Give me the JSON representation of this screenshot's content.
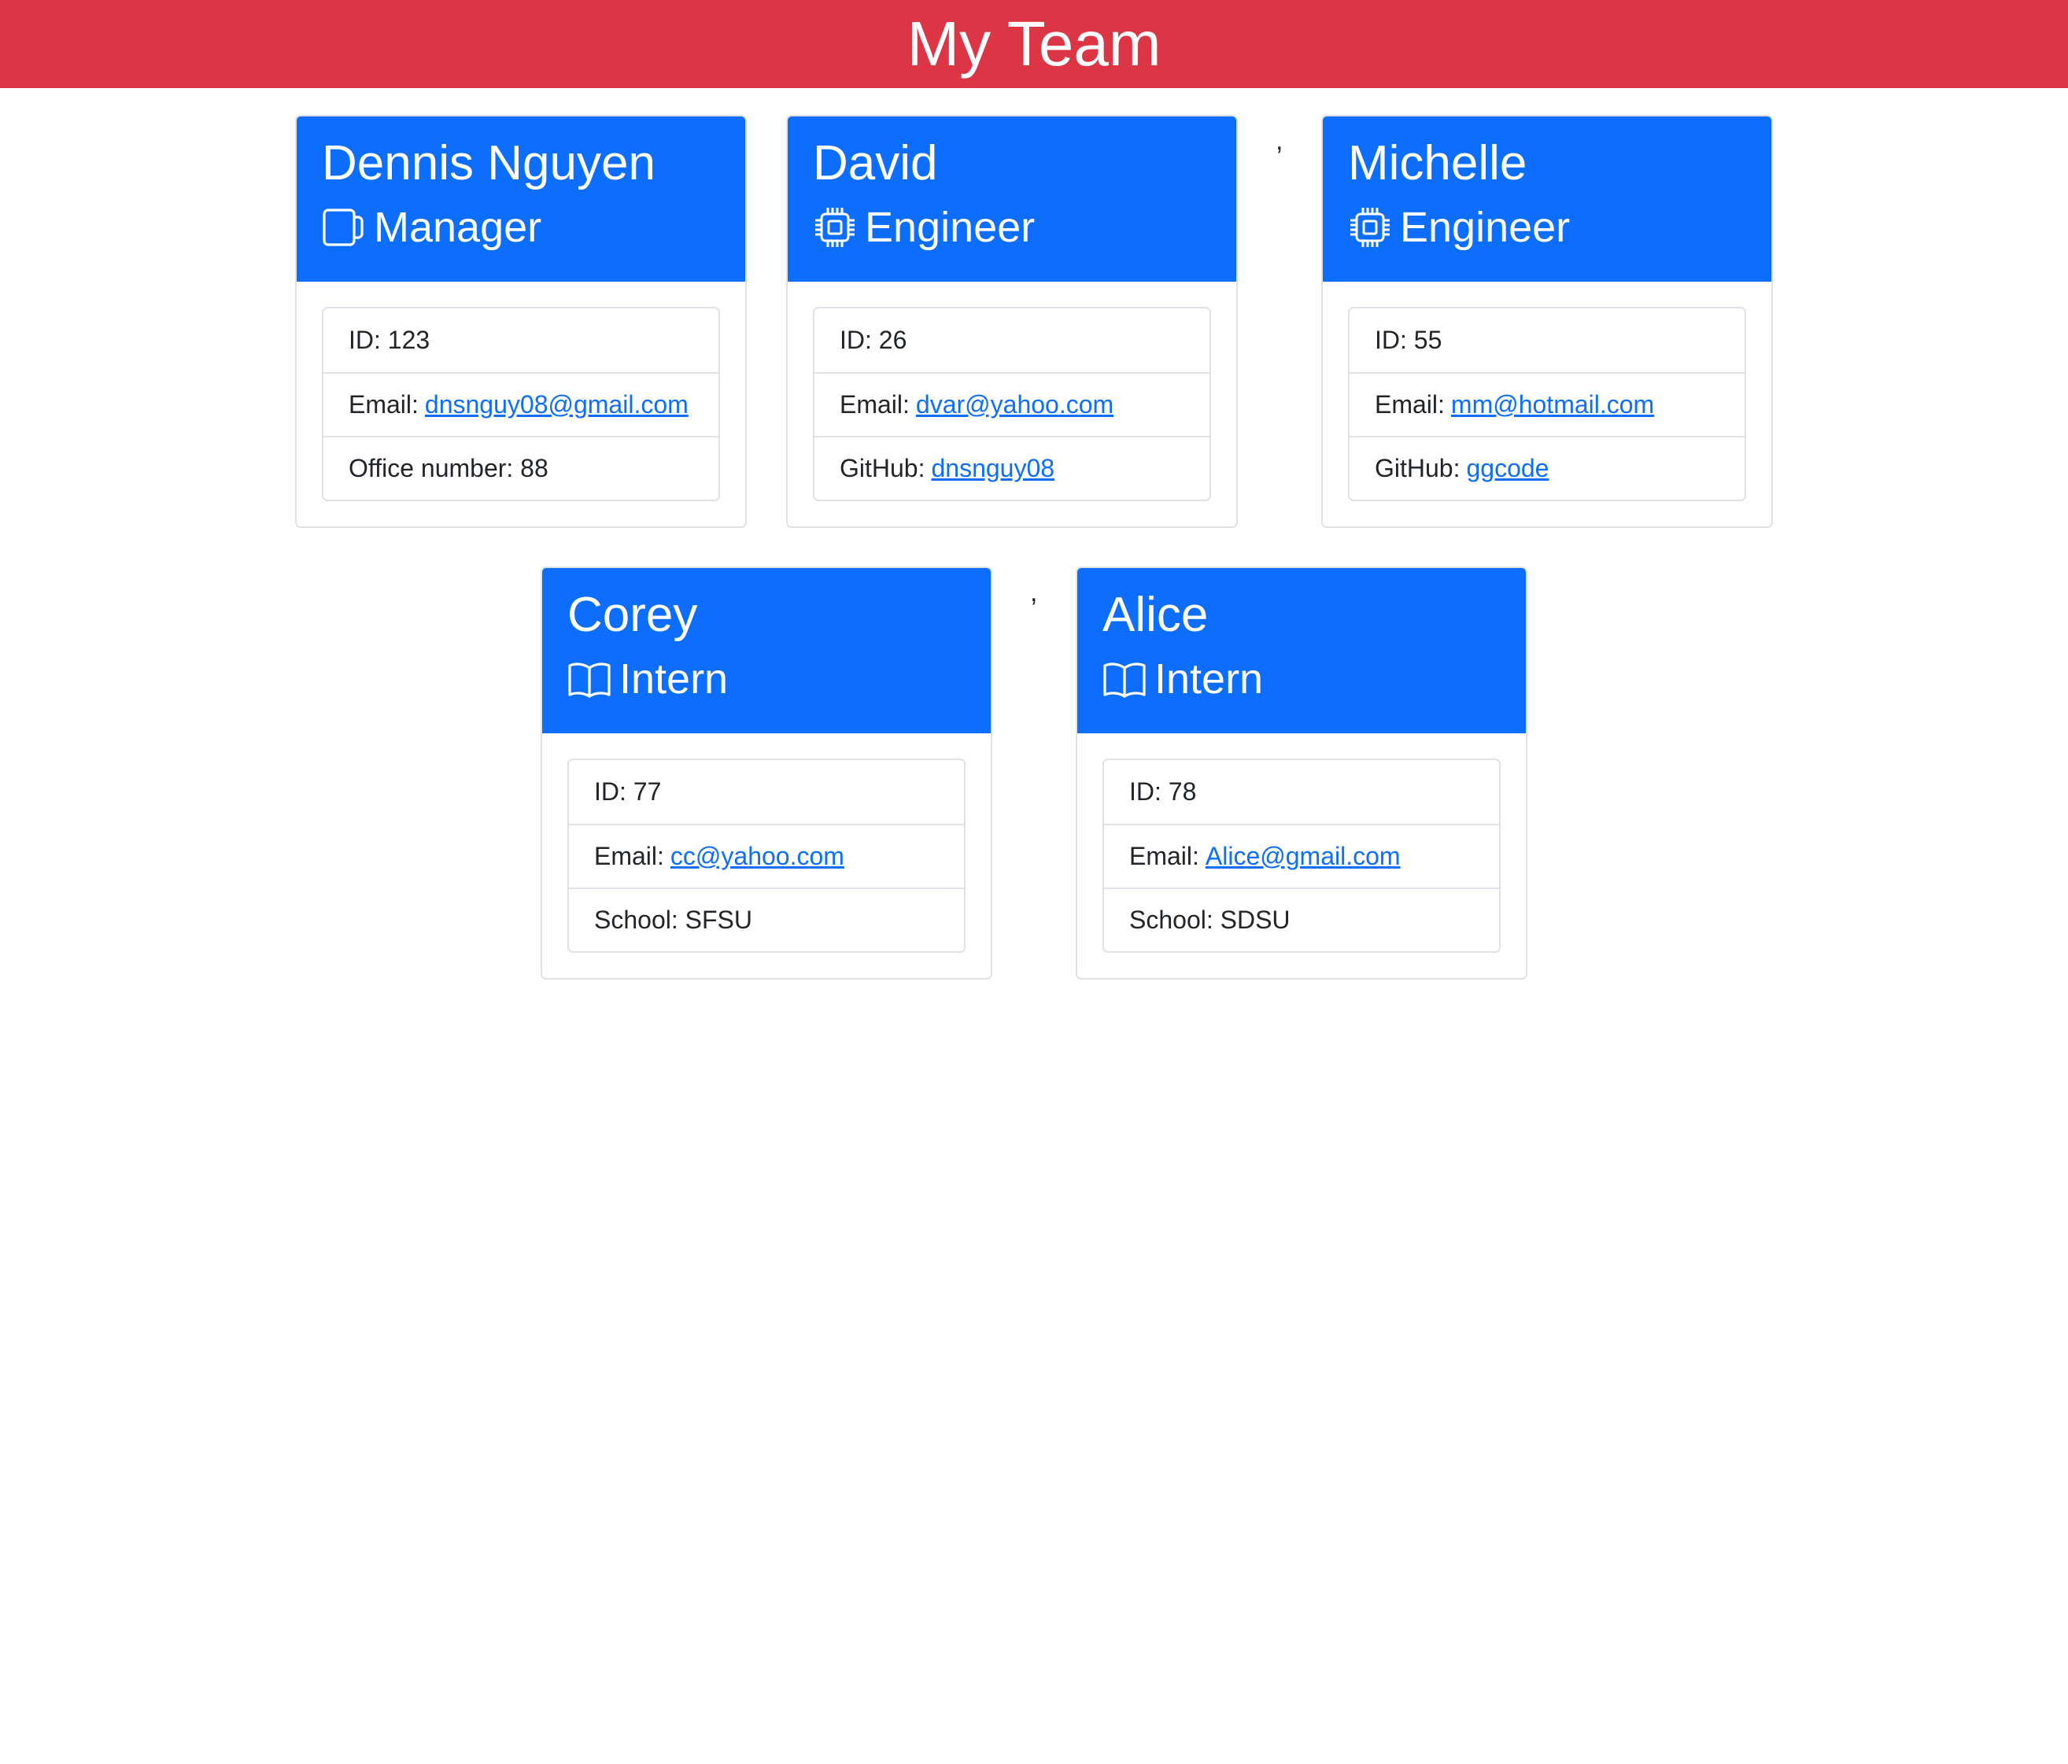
{
  "header": {
    "title": "My Team"
  },
  "separators": {
    "comma": ","
  },
  "employees": [
    {
      "name": "Dennis Nguyen",
      "role": "Manager",
      "icon": "mug-icon",
      "id_label": "ID:",
      "id": "123",
      "email_label": "Email:",
      "email": "dnsnguy08@gmail.com",
      "extra_label": "Office number:",
      "extra": "88"
    },
    {
      "name": "David",
      "role": "Engineer",
      "icon": "cpu-icon",
      "id_label": "ID:",
      "id": "26",
      "email_label": "Email:",
      "email": "dvar@yahoo.com",
      "extra_label": "GitHub:",
      "extra": "dnsnguy08"
    },
    {
      "name": "Michelle",
      "role": "Engineer",
      "icon": "cpu-icon",
      "id_label": "ID:",
      "id": "55",
      "email_label": "Email:",
      "email": "mm@hotmail.com",
      "extra_label": "GitHub:",
      "extra": "ggcode"
    },
    {
      "name": "Corey",
      "role": "Intern",
      "icon": "book-icon",
      "id_label": "ID:",
      "id": "77",
      "email_label": "Email:",
      "email": "cc@yahoo.com",
      "extra_label": "School:",
      "extra": "SFSU"
    },
    {
      "name": "Alice",
      "role": "Intern",
      "icon": "book-icon",
      "id_label": "ID:",
      "id": "78",
      "email_label": "Email:",
      "email": "Alice@gmail.com",
      "extra_label": "School:",
      "extra": "SDSU"
    }
  ],
  "colors": {
    "header_bg": "#dc3545",
    "card_header_bg": "#0d6efd",
    "link": "#0d6efd"
  }
}
